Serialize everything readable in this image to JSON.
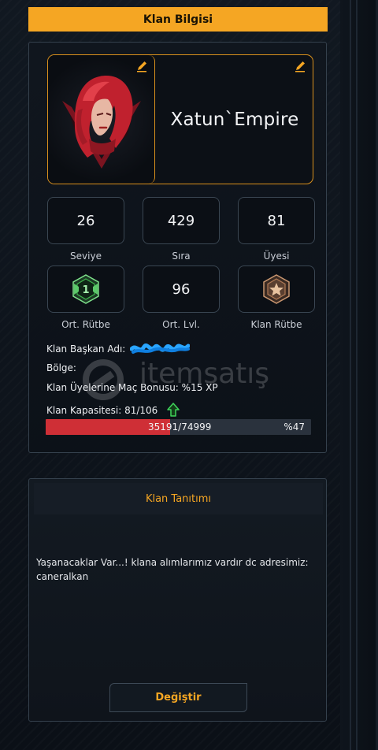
{
  "header": {
    "title": "Klan Bilgisi"
  },
  "clan": {
    "name": "Xatun`Empire",
    "avatar_icon": "red-haired-woman-emblem",
    "edit_icon": "pencil-icon"
  },
  "stats": [
    {
      "value": "26",
      "label": "Seviye"
    },
    {
      "value": "429",
      "label": "Sıra"
    },
    {
      "value": "81",
      "label": "Üyesi"
    },
    {
      "value": "",
      "label": "Ort. Rütbe",
      "icon": "green-rank-badge-icon"
    },
    {
      "value": "96",
      "label": "Ort. Lvl."
    },
    {
      "value": "",
      "label": "Klan Rütbe",
      "icon": "bronze-star-badge-icon"
    }
  ],
  "info": {
    "leader_label": "Klan Başkan Adı:",
    "region_label": "Bölge:",
    "bonus_label": "Klan Üyelerine Maç Bonusu:",
    "bonus_value": "%15 XP",
    "capacity_label": "Klan Kapasitesi:",
    "capacity_value": "81/106",
    "capacity_icon": "green-up-arrow-icon"
  },
  "progress": {
    "text": "35191/74999",
    "percent_label": "%47",
    "fraction": 0.47,
    "fill_color": "#cf2f36"
  },
  "watermark": {
    "text": "itemsatış"
  },
  "intro": {
    "title": "Klan Tanıtımı",
    "description": "Yaşanacaklar Var...!   klana alımlarımız vardır dc adresimiz: caneralkan",
    "button_label": "Değiştir"
  },
  "colors": {
    "accent": "#f5a623",
    "border": "#35414d",
    "danger": "#cf2f36"
  }
}
